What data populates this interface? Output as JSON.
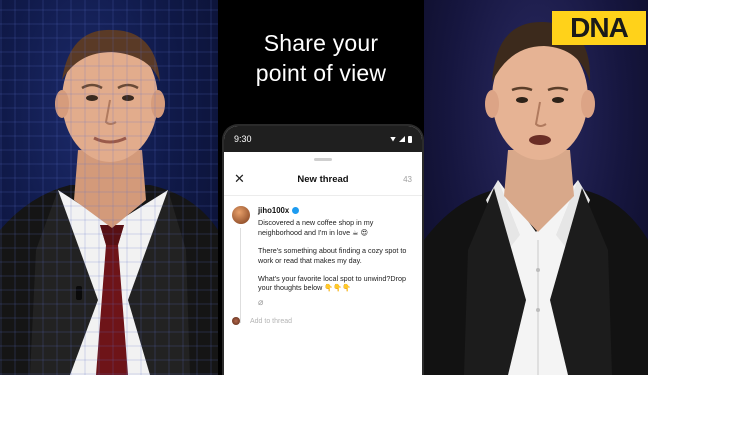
{
  "headline": {
    "line1": "Share your",
    "line2": "point of view"
  },
  "phone": {
    "status_time": "9:30",
    "sheet": {
      "title": "New thread",
      "close_icon": "close-icon",
      "char_count": "43"
    },
    "post": {
      "username": "jiho100x",
      "verified_icon": "verified-badge-icon",
      "paragraphs": [
        "Discovered a new coffee shop in my neighborhood and I'm in love ☕ 😍",
        "There's something about finding a cozy spot to work or read that makes my day.",
        "What's your favorite local spot to unwind?Drop your thoughts below 👇👇👇"
      ],
      "attach_icon": "paperclip-icon"
    },
    "add_to_thread": "Add to thread"
  },
  "badge": {
    "text": "DNA",
    "color": "#ffd21a"
  },
  "colors": {
    "panel_bg": "#000000",
    "verified": "#1d9bf0"
  }
}
